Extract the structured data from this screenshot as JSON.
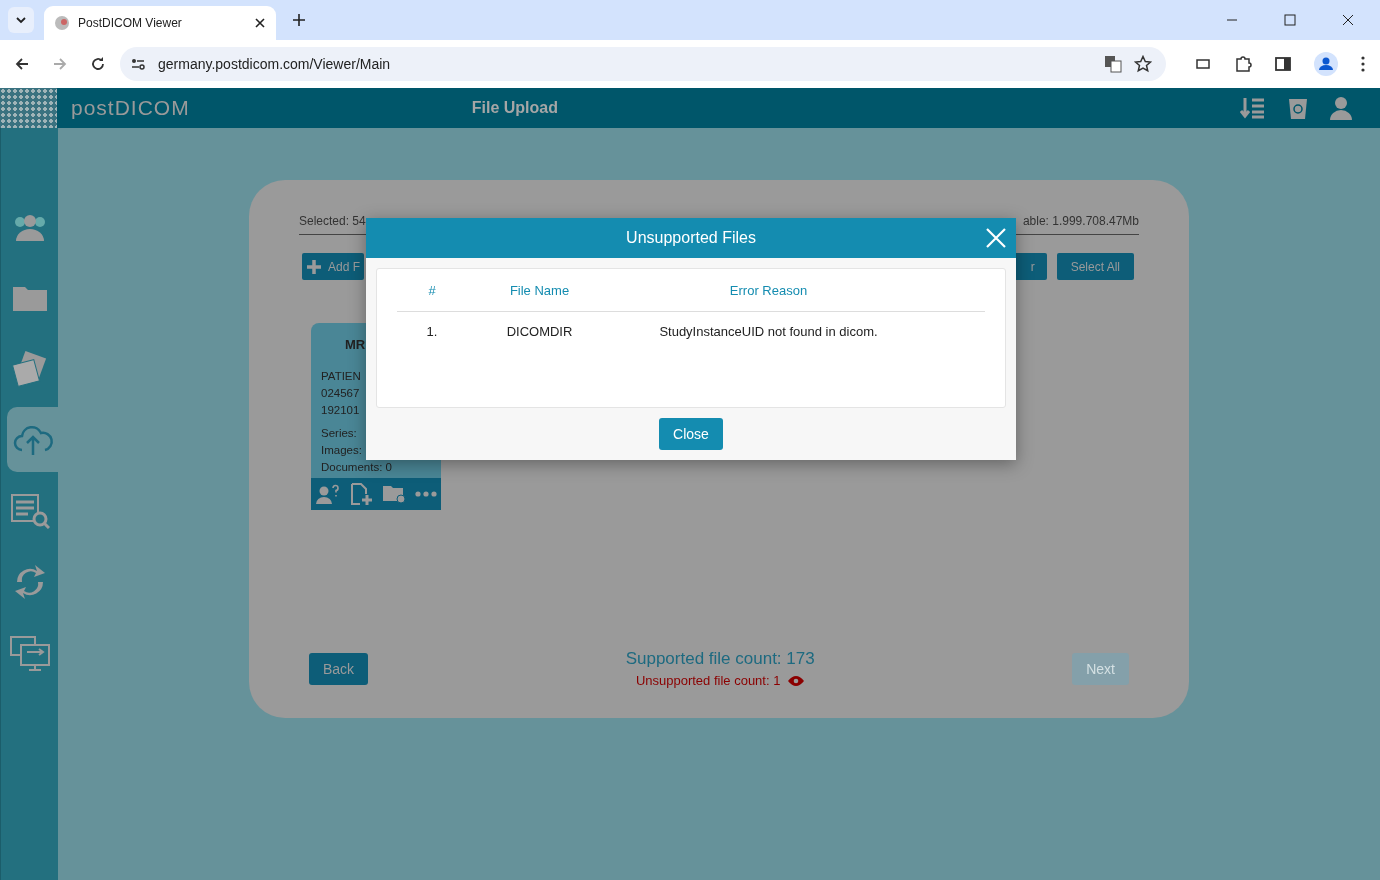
{
  "browser": {
    "tab_title": "PostDICOM Viewer",
    "url": "germany.postdicom.com/Viewer/Main"
  },
  "app": {
    "logo": "postDICOM",
    "title": "File Upload"
  },
  "sidebar": {
    "items": [
      {
        "selected": false
      },
      {
        "selected": false
      },
      {
        "selected": false
      },
      {
        "selected": true
      },
      {
        "selected": false
      },
      {
        "selected": false
      },
      {
        "selected": false
      }
    ]
  },
  "panel": {
    "selected_text": "Selected: 54",
    "available_text": "able: 1.999.708.47Mb",
    "add_button": "Add F",
    "hidden_button": "r",
    "select_all_button": "Select All",
    "study_card": {
      "title": "MR",
      "lines": [
        "PATIEN",
        "024567",
        "192101"
      ],
      "series": "Series:",
      "images": "Images:",
      "documents": "Documents: 0"
    },
    "back_button": "Back",
    "next_button": {
      "label": "Next",
      "disabled": true
    },
    "supported_count": "Supported file count: 173",
    "unsupported_count": "Unsupported file count: 1"
  },
  "modal": {
    "title": "Unsupported Files",
    "columns": [
      "#",
      "File Name",
      "Error Reason"
    ],
    "rows": [
      {
        "index": "1.",
        "file_name": "DICOMDIR",
        "reason": "StudyInstanceUID not found in dicom."
      }
    ],
    "close_button": "Close"
  }
}
